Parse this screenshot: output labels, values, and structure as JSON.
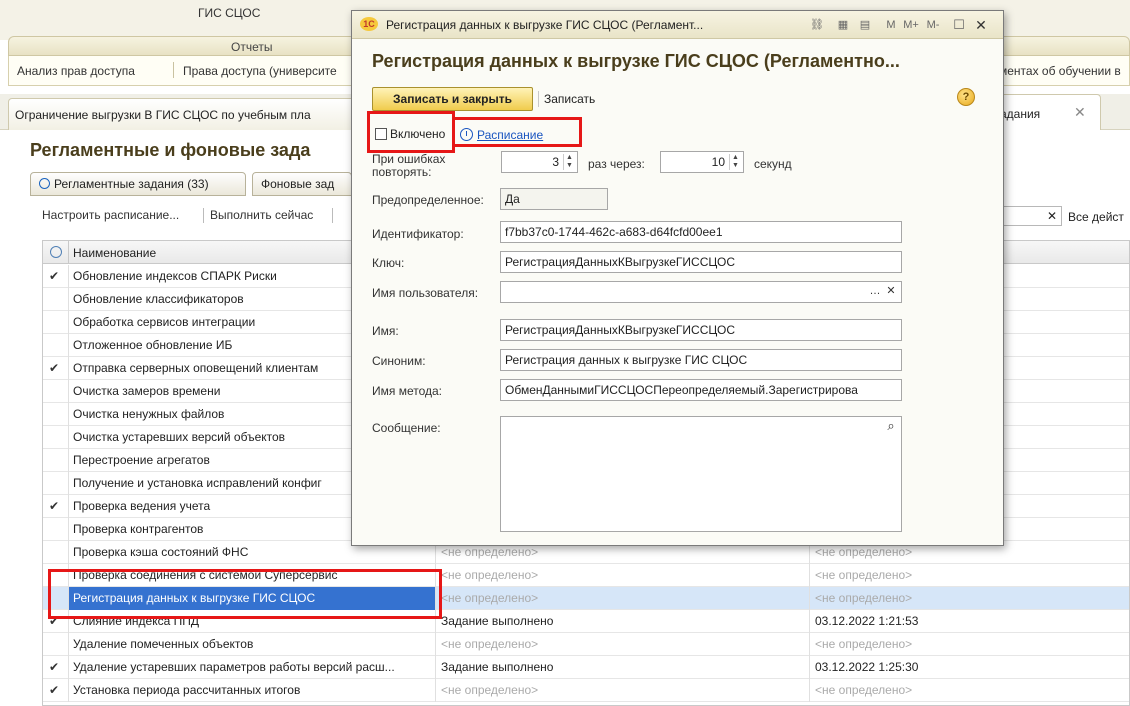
{
  "app": {
    "title": "ГИС СЦОС",
    "reports_section": "Отчеты",
    "report_links": [
      "Анализ прав доступа",
      "Права доступа (университе",
      "ментах об обучении в"
    ],
    "open_tab_left": "Ограничение выгрузки В ГИС СЦОС по учебным пла",
    "open_tab_right": "адания",
    "page_heading": "Регламентные и фоновые зада",
    "subtabs": [
      "Регламентные задания (33)",
      "Фоновые зад"
    ],
    "toolbar": [
      "Настроить расписание...",
      "Выполнить сейчас"
    ],
    "all_actions": "Все дейст",
    "grid_header": "Наименование",
    "rows": [
      {
        "check": "✔",
        "name": "Обновление индексов СПАРК Риски",
        "c2": "",
        "c3": ""
      },
      {
        "check": "",
        "name": "Обновление классификаторов",
        "c2": "",
        "c3": ""
      },
      {
        "check": "",
        "name": "Обработка сервисов интеграции",
        "c2": "",
        "c3": ""
      },
      {
        "check": "",
        "name": "Отложенное обновление ИБ",
        "c2": "",
        "c3": ""
      },
      {
        "check": "✔",
        "name": "Отправка серверных оповещений клиентам",
        "c2": "",
        "c3": ""
      },
      {
        "check": "",
        "name": "Очистка замеров времени",
        "c2": "",
        "c3": ""
      },
      {
        "check": "",
        "name": "Очистка ненужных файлов",
        "c2": "",
        "c3": ""
      },
      {
        "check": "",
        "name": "Очистка устаревших версий объектов",
        "c2": "",
        "c3": ""
      },
      {
        "check": "",
        "name": "Перестроение агрегатов",
        "c2": "",
        "c3": ""
      },
      {
        "check": "",
        "name": "Получение и установка исправлений конфиг",
        "c2": "",
        "c3": ""
      },
      {
        "check": "✔",
        "name": "Проверка ведения учета",
        "c2": "",
        "c3": ""
      },
      {
        "check": "",
        "name": "Проверка контрагентов",
        "c2": "",
        "c3": ""
      },
      {
        "check": "",
        "name": "Проверка кэша состояний ФНС",
        "c2": "<не определено>",
        "c3": "<не определено>"
      },
      {
        "check": "",
        "name": "Проверка соединения с системой Суперсервис",
        "c2": "<не определено>",
        "c3": "<не определено>"
      },
      {
        "check": "",
        "name": "Регистрация данных к выгрузке ГИС СЦОС",
        "c2": "<не определено>",
        "c3": "<не определено>"
      },
      {
        "check": "✔",
        "name": "Слияние индекса ППД",
        "c2": "Задание выполнено",
        "c3": "03.12.2022 1:21:53"
      },
      {
        "check": "",
        "name": "Удаление помеченных объектов",
        "c2": "<не определено>",
        "c3": "<не определено>"
      },
      {
        "check": "✔",
        "name": "Удаление устаревших параметров работы версий расш...",
        "c2": "Задание выполнено",
        "c3": "03.12.2022 1:25:30"
      },
      {
        "check": "✔",
        "name": "Установка периода рассчитанных итогов",
        "c2": "<не определено>",
        "c3": "<не определено>"
      }
    ]
  },
  "modal": {
    "window_title": "Регистрация данных к выгрузке ГИС СЦОС (Регламент...",
    "logo_text": "1С",
    "tb_icons": [
      "M",
      "M+",
      "M-"
    ],
    "heading": "Регистрация данных к выгрузке ГИС СЦОС (Регламентно...",
    "save_close": "Записать и закрыть",
    "save": "Записать",
    "help": "?",
    "enabled_label": "Включено",
    "schedule_link": "Расписание",
    "retry_label": "При ошибках повторять:",
    "retry_count": "3",
    "retry_mid": "раз через:",
    "retry_interval": "10",
    "retry_unit": "секунд",
    "predefined_label": "Предопределенное:",
    "predefined_value": "Да",
    "id_label": "Идентификатор:",
    "id_value": "f7bb37c0-1744-462c-a683-d64fcfd00ee1",
    "key_label": "Ключ:",
    "key_value": "РегистрацияДанныхКВыгрузкеГИССЦОС",
    "user_label": "Имя пользователя:",
    "user_value": "",
    "name_label": "Имя:",
    "name_value": "РегистрацияДанныхКВыгрузкеГИССЦОС",
    "synonym_label": "Синоним:",
    "synonym_value": "Регистрация данных к выгрузке ГИС СЦОС",
    "method_label": "Имя метода:",
    "method_value": "ОбменДаннымиГИССЦОСПереопределяемый.Зарегистрирова",
    "message_label": "Сообщение:",
    "message_value": ""
  },
  "colors": {
    "highlight": "#e61717",
    "selected_row": "#3572d0",
    "primary_button": "#f0cc4d"
  }
}
